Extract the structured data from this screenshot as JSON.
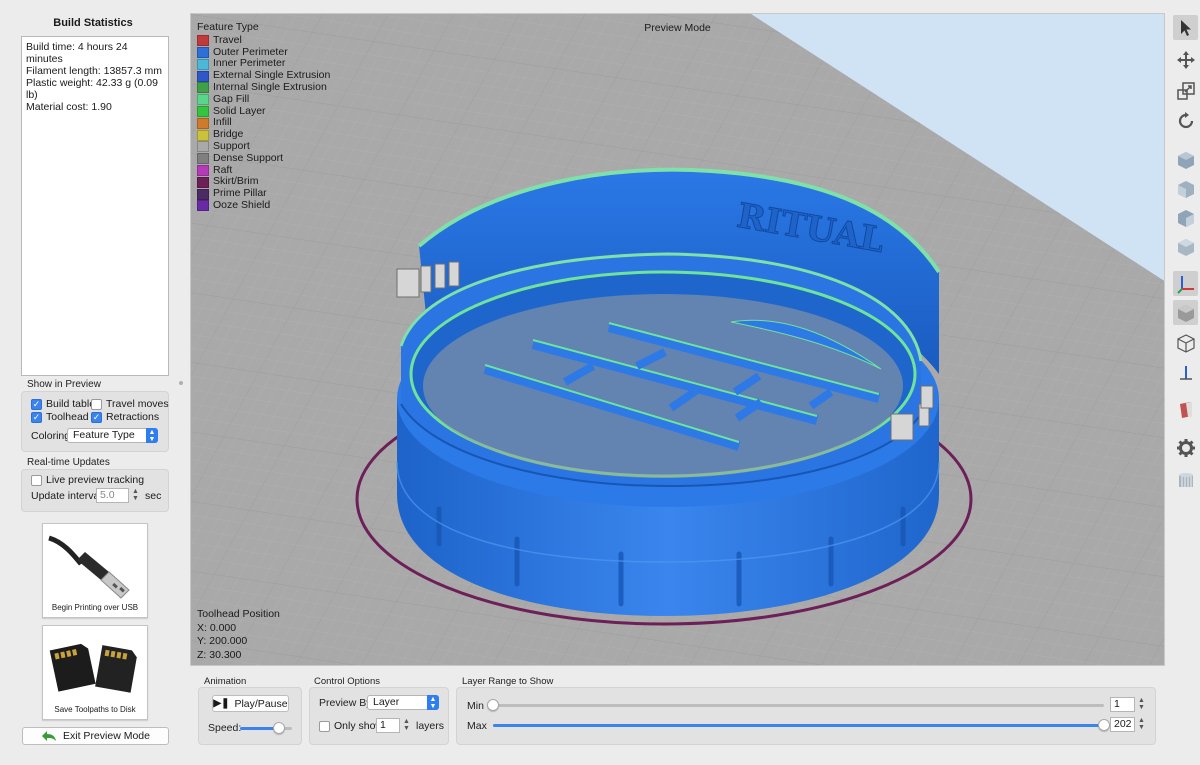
{
  "build_stats": {
    "title": "Build Statistics",
    "lines": [
      "Build time: 4 hours 24 minutes",
      "Filament length: 13857.3 mm",
      "Plastic weight: 42.33 g (0.09 lb)",
      "Material cost: 1.90"
    ]
  },
  "show_in_preview": {
    "label": "Show in Preview",
    "build_table": {
      "label": "Build table",
      "checked": true
    },
    "travel_moves": {
      "label": "Travel moves",
      "checked": false
    },
    "toolhead": {
      "label": "Toolhead",
      "checked": true
    },
    "retractions": {
      "label": "Retractions",
      "checked": true
    },
    "coloring_label": "Coloring",
    "coloring_value": "Feature Type"
  },
  "realtime": {
    "label": "Real-time Updates",
    "live_tracking": {
      "label": "Live preview tracking",
      "checked": false
    },
    "interval_label": "Update interval",
    "interval_value": "5.0",
    "interval_unit": "sec"
  },
  "cards": {
    "usb_caption": "Begin Printing over USB",
    "disk_caption": "Save Toolpaths to Disk"
  },
  "exit_button": "Exit Preview Mode",
  "viewport": {
    "mode_title": "Preview Mode",
    "legend_title": "Feature Type",
    "legend": [
      {
        "label": "Travel",
        "color": "#c0393b"
      },
      {
        "label": "Outer Perimeter",
        "color": "#2f6fd8"
      },
      {
        "label": "Inner Perimeter",
        "color": "#4bb8d8"
      },
      {
        "label": "External Single Extrusion",
        "color": "#2e57c7"
      },
      {
        "label": "Internal Single Extrusion",
        "color": "#3fa04a"
      },
      {
        "label": "Gap Fill",
        "color": "#5ad58a"
      },
      {
        "label": "Solid Layer",
        "color": "#35c43e"
      },
      {
        "label": "Infill",
        "color": "#d07a2c"
      },
      {
        "label": "Bridge",
        "color": "#c9c23a"
      },
      {
        "label": "Support",
        "color": "#a9a9a9"
      },
      {
        "label": "Dense Support",
        "color": "#7f7f7f"
      },
      {
        "label": "Raft",
        "color": "#b43ab8"
      },
      {
        "label": "Skirt/Brim",
        "color": "#6d1f58"
      },
      {
        "label": "Prime Pillar",
        "color": "#4c2a63"
      },
      {
        "label": "Ooze Shield",
        "color": "#6a2aa6"
      }
    ],
    "model_text": "RITUAL",
    "toolhead": {
      "title": "Toolhead Position",
      "x": "X: 0.000",
      "y": "Y: 200.000",
      "z": "Z: 30.300"
    }
  },
  "animation": {
    "label": "Animation",
    "play_label": "Play/Pause",
    "speed_label": "Speed:",
    "speed_fraction": 0.75
  },
  "control_options": {
    "label": "Control Options",
    "preview_by_label": "Preview By",
    "preview_by_value": "Layer",
    "only_show_label": "Only show",
    "only_show_checked": false,
    "only_show_value": "1",
    "layers_label": "layers"
  },
  "layer_range": {
    "label": "Layer Range to Show",
    "min_label": "Min",
    "max_label": "Max",
    "min_value": "1",
    "max_value": "202",
    "total_layers": 202
  },
  "toolbar": {
    "tools": [
      "select-arrow-icon",
      "move-icon",
      "scale-icon",
      "rotate-icon",
      "view-iso-icon",
      "view-front-icon",
      "view-back-icon",
      "view-side-icon",
      "axes-icon",
      "solid-cube-icon",
      "wireframe-cube-icon",
      "axis-z-icon",
      "section-icon",
      "settings-gear-icon",
      "slice-view-icon"
    ]
  }
}
